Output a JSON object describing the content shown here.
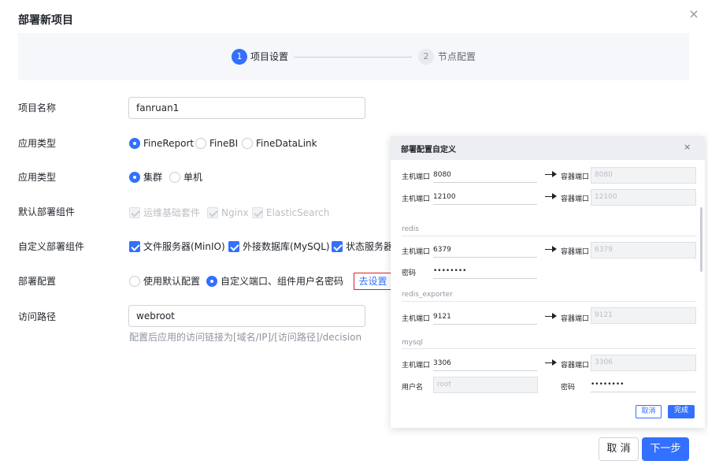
{
  "dialog": {
    "title": "部署新项目",
    "close_icon": "×"
  },
  "steps": [
    {
      "num": "1",
      "label": "项目设置",
      "state": "active"
    },
    {
      "num": "2",
      "label": "节点配置",
      "state": "inactive"
    }
  ],
  "form": {
    "project_name": {
      "label": "项目名称",
      "value": "fanruan1"
    },
    "app_type": {
      "label": "应用类型",
      "options": [
        "FineReport",
        "FineBI",
        "FineDataLink"
      ],
      "selected": "FineReport"
    },
    "deploy_type": {
      "label": "应用类型",
      "options": [
        "集群",
        "单机"
      ],
      "selected": "集群"
    },
    "default_components": {
      "label": "默认部署组件",
      "options": [
        "运维基础套件",
        "Nginx",
        "ElasticSearch"
      ]
    },
    "custom_components": {
      "label": "自定义部署组件",
      "options": [
        "文件服务器(MinIO)",
        "外接数据库(MySQL)",
        "状态服务器"
      ]
    },
    "deploy_config": {
      "label": "部署配置",
      "options": [
        "使用默认配置",
        "自定义端口、组件用户名密码"
      ],
      "selected": "自定义端口、组件用户名密码",
      "link": "去设置"
    },
    "access_path": {
      "label": "访问路径",
      "value": "webroot",
      "hint": "配置后应用的访问链接为[域名/IP]/[访问路径]/decision"
    }
  },
  "footer": {
    "cancel": "取 消",
    "next": "下一步"
  },
  "panel": {
    "title": "部署配置自定义",
    "close": "×",
    "host_port_label": "主机端口",
    "container_port_label": "容器端口",
    "password_label": "密码",
    "username_label": "用户名",
    "rows": {
      "row1": {
        "host": "8080",
        "container": "8080"
      },
      "row2": {
        "host": "12100",
        "container": "12100"
      },
      "redis_section": "redis",
      "redis": {
        "host": "6379",
        "container": "6379",
        "password": "••••••••"
      },
      "exporter_section": "redis_exporter",
      "exporter": {
        "host": "9121",
        "container": "9121"
      },
      "mysql_section": "mysql",
      "mysql": {
        "host": "3306",
        "container": "3306",
        "username": "root",
        "password": "••••••••"
      }
    },
    "cancel": "取消",
    "done": "完成"
  },
  "colors": {
    "primary": "#3370ff",
    "highlight": "#e02020"
  }
}
